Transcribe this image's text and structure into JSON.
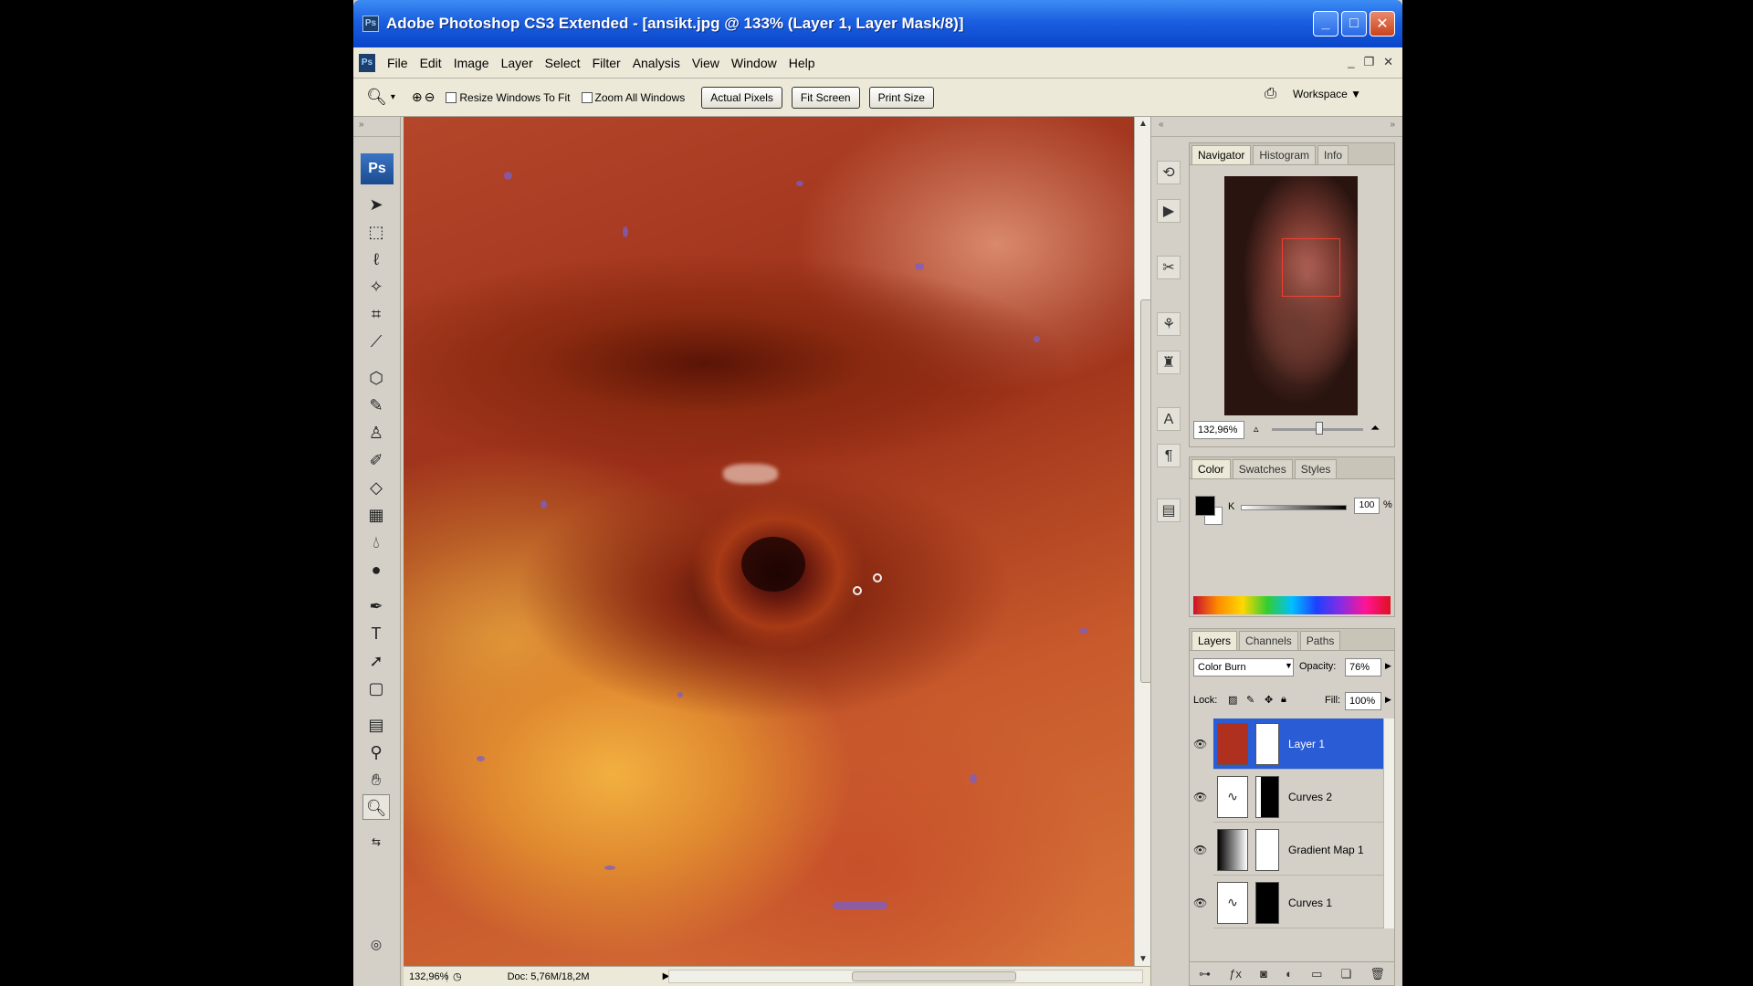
{
  "window": {
    "title": "Adobe Photoshop CS3 Extended - [ansikt.jpg @ 133% (Layer 1, Layer Mask/8)]",
    "app_icon": "Ps",
    "controls": [
      "_",
      "□",
      "✕"
    ]
  },
  "menu": {
    "items": [
      "File",
      "Edit",
      "Image",
      "Layer",
      "Select",
      "Filter",
      "Analysis",
      "View",
      "Window",
      "Help"
    ],
    "mdi_controls": [
      "_",
      "❐",
      "✕"
    ]
  },
  "options_bar": {
    "tool_icon": "zoom-icon",
    "resize_windows_label": "Resize Windows To Fit",
    "zoom_all_label": "Zoom All Windows",
    "actual_pixels_label": "Actual Pixels",
    "fit_screen_label": "Fit Screen",
    "print_size_label": "Print Size",
    "workspace_label": "Workspace ▼"
  },
  "tools": {
    "logo": "Ps",
    "items": [
      "move",
      "marquee",
      "lasso",
      "magic-wand",
      "crop",
      "slice",
      "healing",
      "brush",
      "stamp",
      "history-brush",
      "eraser",
      "gradient",
      "blur",
      "dodge",
      "pen",
      "type",
      "path-select",
      "shape",
      "notes",
      "eyedropper",
      "hand",
      "zoom"
    ]
  },
  "status": {
    "zoom": "132,96%",
    "doc": "Doc: 5,76M/18,2M"
  },
  "navigator": {
    "tabs": [
      "Navigator",
      "Histogram",
      "Info"
    ],
    "zoom": "132,96%"
  },
  "color_panel": {
    "tabs": [
      "Color",
      "Swatches",
      "Styles"
    ],
    "channel_label": "K",
    "value": "100",
    "unit": "%"
  },
  "layers_panel": {
    "tabs": [
      "Layers",
      "Channels",
      "Paths"
    ],
    "blend_mode": "Color Burn",
    "opacity_label": "Opacity:",
    "opacity_value": "76%",
    "lock_label": "Lock:",
    "fill_label": "Fill:",
    "fill_value": "100%",
    "layers": [
      {
        "name": "Layer 1",
        "selected": true
      },
      {
        "name": "Curves 2",
        "selected": false
      },
      {
        "name": "Gradient Map 1",
        "selected": false
      },
      {
        "name": "Curves 1",
        "selected": false
      }
    ]
  }
}
